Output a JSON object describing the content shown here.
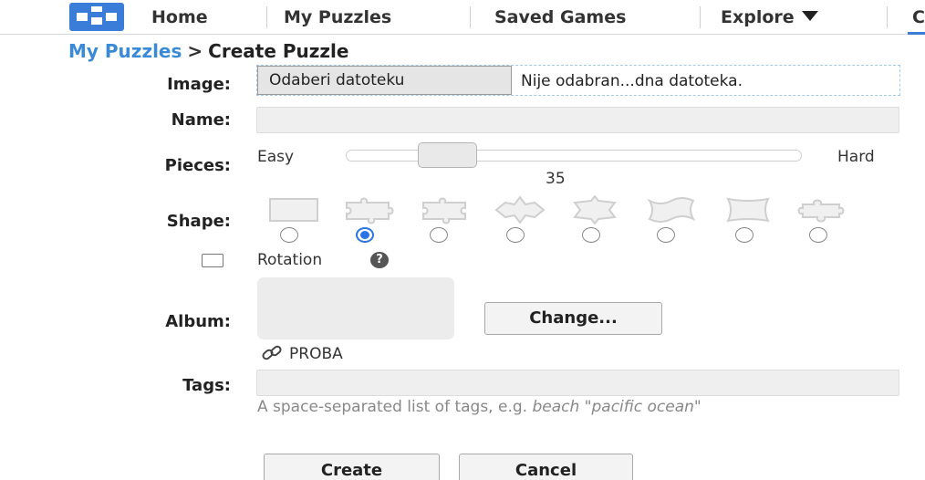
{
  "nav": {
    "home": "Home",
    "my_puzzles": "My Puzzles",
    "saved_games": "Saved Games",
    "explore": "Explore",
    "partial_item": "C"
  },
  "breadcrumb": {
    "parent": "My Puzzles",
    "separator": ">",
    "current": "Create Puzzle"
  },
  "form": {
    "image_label": "Image:",
    "file_button": "Odaberi datoteku",
    "file_status": "Nije odabran...dna datoteka.",
    "name_label": "Name:",
    "name_value": "",
    "pieces_label": "Pieces:",
    "pieces_easy": "Easy",
    "pieces_hard": "Hard",
    "pieces_value": "35",
    "pieces_slider_fraction": 0.2,
    "shape_label": "Shape:",
    "shapes": [
      "square",
      "classic",
      "mixed",
      "star",
      "jagged",
      "wavy",
      "curved",
      "puzzle-round"
    ],
    "selected_shape_index": 1,
    "rotation_label": "Rotation",
    "rotation_checked": false,
    "album_label": "Album:",
    "album_change": "Change...",
    "album_name": "PROBA",
    "tags_label": "Tags:",
    "tags_value": "",
    "tags_help_prefix": "A space-separated list of tags, e.g.",
    "tags_help_example": "beach \"pacific ocean\"",
    "create_button": "Create",
    "cancel_button": "Cancel"
  },
  "colors": {
    "accent": "#3a7dd8",
    "link": "#3a8ad6",
    "radio_selected": "#2a74e6"
  }
}
